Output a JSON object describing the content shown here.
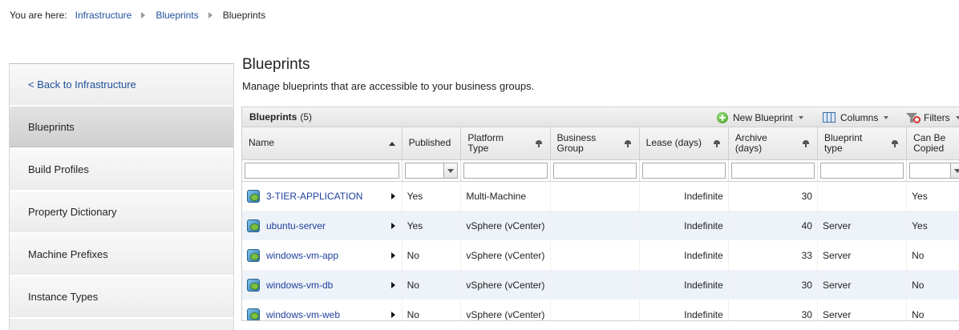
{
  "breadcrumb": {
    "prefix": "You are here:",
    "items": [
      "Infrastructure",
      "Blueprints",
      "Blueprints"
    ]
  },
  "sidebar": {
    "items": [
      {
        "label": "< Back to Infrastructure"
      },
      {
        "label": "Blueprints"
      },
      {
        "label": "Build Profiles"
      },
      {
        "label": "Property Dictionary"
      },
      {
        "label": "Machine Prefixes"
      },
      {
        "label": "Instance Types"
      }
    ]
  },
  "main": {
    "title": "Blueprints",
    "description": "Manage blueprints that are accessible to your business groups."
  },
  "panel": {
    "title": "Blueprints",
    "count": "(5)",
    "toolbar": {
      "new_blueprint": "New Blueprint",
      "columns": "Columns",
      "filters": "Filters"
    }
  },
  "table": {
    "columns": [
      "Name",
      "Published",
      "Platform Type",
      "Business Group",
      "Lease (days)",
      "Archive (days)",
      "Blueprint type",
      "Can Be Copied"
    ],
    "rows": [
      {
        "name": "3-TIER-APPLICATION",
        "published": "Yes",
        "platform": "Multi-Machine",
        "group": "",
        "lease": "Indefinite",
        "archive": "30",
        "type": "",
        "copied": "Yes"
      },
      {
        "name": "ubuntu-server",
        "published": "Yes",
        "platform": "vSphere (vCenter)",
        "group": "",
        "lease": "Indefinite",
        "archive": "40",
        "type": "Server",
        "copied": "Yes"
      },
      {
        "name": "windows-vm-app",
        "published": "No",
        "platform": "vSphere (vCenter)",
        "group": "",
        "lease": "Indefinite",
        "archive": "33",
        "type": "Server",
        "copied": "No"
      },
      {
        "name": "windows-vm-db",
        "published": "No",
        "platform": "vSphere (vCenter)",
        "group": "",
        "lease": "Indefinite",
        "archive": "30",
        "type": "Server",
        "copied": "No"
      },
      {
        "name": "windows-vm-web",
        "published": "No",
        "platform": "vSphere (vCenter)",
        "group": "",
        "lease": "Indefinite",
        "archive": "30",
        "type": "Server",
        "copied": "No"
      }
    ]
  },
  "icons": {
    "breadcrumb_separator": "triangle-right",
    "new_blueprint": "plus-circle-icon",
    "columns": "columns-icon",
    "filters": "filter-icon",
    "row": "blueprint-icon"
  },
  "colors": {
    "link": "#1f4f9c",
    "alt_row": "#edf3f9",
    "active_nav": "#d6d6d6"
  }
}
